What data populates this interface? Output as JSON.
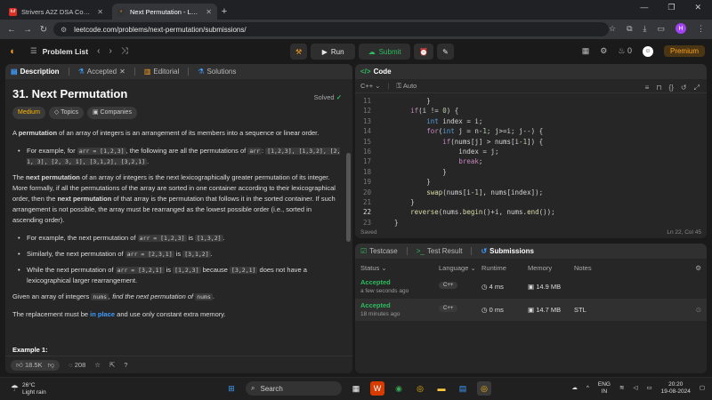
{
  "browser": {
    "tabs": [
      {
        "title": "Strivers A2Z DSA Course/Sheet",
        "active": false
      },
      {
        "title": "Next Permutation - LeetCode",
        "active": true
      }
    ],
    "url": "leetcode.com/problems/next-permutation/submissions/",
    "profile_initial": "H"
  },
  "header": {
    "problem_list": "Problem List",
    "run": "Run",
    "submit": "Submit",
    "streak": "0",
    "premium": "Premium"
  },
  "left_tabs": [
    "Description",
    "Accepted",
    "Editorial",
    "Solutions"
  ],
  "problem": {
    "title": "31. Next Permutation",
    "solved": "Solved",
    "difficulty": "Medium",
    "topics": "Topics",
    "companies": "Companies",
    "intro_a": "A ",
    "intro_b": "permutation",
    "intro_c": " of an array of integers is an arrangement of its members into a sequence or linear order.",
    "ex1_a": "For example, for ",
    "ex1_code": "arr = [1,2,3]",
    "ex1_b": ", the following are all the permutations of ",
    "ex1_code2": "arr",
    "ex1_c": ": ",
    "ex1_list": "[1,2,3], [1,3,2], [2, 1, 3], [2, 3, 1], [3,1,2], [3,2,1]",
    "ex1_d": ".",
    "next_a": "The ",
    "next_b": "next permutation",
    "next_c": " of an array of integers is the next lexicographically greater permutation of its integer. More formally, if all the permutations of the array are sorted in one container according to their lexicographical order, then the ",
    "next_d": "next permutation",
    "next_e": " of that array is the permutation that follows it in the sorted container. If such arrangement is not possible, the array must be rearranged as the lowest possible order (i.e., sorted in ascending order).",
    "b1_a": "For example, the next permutation of ",
    "b1_c1": "arr = [1,2,3]",
    "b1_b": " is ",
    "b1_c2": "[1,3,2]",
    "b1_d": ".",
    "b2_a": "Similarly, the next permutation of ",
    "b2_c1": "arr = [2,3,1]",
    "b2_b": " is ",
    "b2_c2": "[3,1,2]",
    "b2_d": ".",
    "b3_a": "While the next permutation of ",
    "b3_c1": "arr = [3,2,1]",
    "b3_b": " is ",
    "b3_c2": "[1,2,3]",
    "b3_c": " because ",
    "b3_c3": "[3,2,1]",
    "b3_d": " does not have a lexicographical larger rearrangement.",
    "given_a": "Given an array of integers ",
    "given_code": "nums",
    "given_b": ", find the next permutation of ",
    "given_code2": "nums",
    "given_c": ".",
    "repl_a": "The replacement must be ",
    "repl_b": "in place",
    "repl_c": " and use only constant extra memory.",
    "example": "Example 1:",
    "likes": "18.5K",
    "comments": "208"
  },
  "code": {
    "tab": "Code",
    "lang": "C++",
    "auto": "Auto",
    "saved": "Saved",
    "cursor": "Ln 22, Col 45",
    "lines": [
      {
        "n": "11",
        "t": "            }"
      },
      {
        "n": "12",
        "t": "        if(i != 0) {"
      },
      {
        "n": "13",
        "t": "            int index = i;"
      },
      {
        "n": "14",
        "t": "            for(int j = n-1; j>=i; j--) {"
      },
      {
        "n": "15",
        "t": "                if(nums[j] > nums[i-1]) {"
      },
      {
        "n": "16",
        "t": "                    index = j;"
      },
      {
        "n": "17",
        "t": "                    break;"
      },
      {
        "n": "18",
        "t": "                }"
      },
      {
        "n": "19",
        "t": "            }"
      },
      {
        "n": "20",
        "t": "            swap(nums[i-1], nums[index]);"
      },
      {
        "n": "21",
        "t": "        }"
      },
      {
        "n": "22",
        "t": "        reverse(nums.begin()+i, nums.end());"
      },
      {
        "n": "23",
        "t": "    }"
      }
    ]
  },
  "bottom_tabs": [
    "Testcase",
    "Test Result",
    "Submissions"
  ],
  "submissions": {
    "headers": {
      "status": "Status",
      "language": "Language",
      "runtime": "Runtime",
      "memory": "Memory",
      "notes": "Notes"
    },
    "rows": [
      {
        "status": "Accepted",
        "when": "a few seconds ago",
        "lang": "C++",
        "runtime": "4 ms",
        "memory": "14.9 MB",
        "notes": ""
      },
      {
        "status": "Accepted",
        "when": "18 minutes ago",
        "lang": "C++",
        "runtime": "0 ms",
        "memory": "14.7 MB",
        "notes": "STL"
      }
    ]
  },
  "taskbar": {
    "temp": "26°C",
    "weather": "Light rain",
    "search": "Search",
    "lang1": "ENG",
    "lang2": "IN",
    "time": "20:20",
    "date": "19-08-2024"
  }
}
